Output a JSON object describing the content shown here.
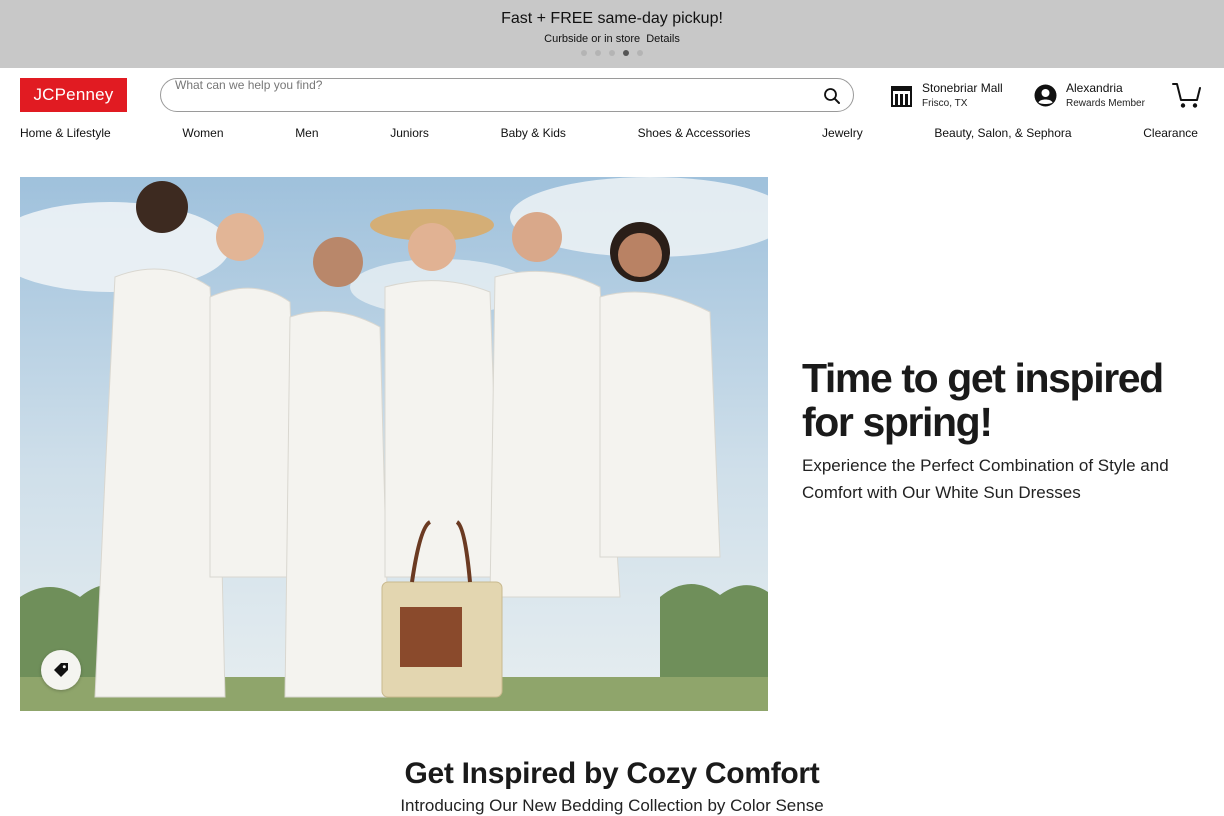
{
  "promo": {
    "title": "Fast + FREE same-day pickup!",
    "subtitle": "Curbside or in store",
    "details_link": "Details",
    "slide_count": 5,
    "active_slide": 4
  },
  "header": {
    "logo_text": "JCPenney",
    "search_placeholder": "What can we help you find?",
    "store": {
      "name": "Stonebriar Mall",
      "location": "Frisco, TX"
    },
    "account": {
      "name": "Alexandria",
      "status": "Rewards Member"
    }
  },
  "nav": {
    "items": [
      "Home & Lifestyle",
      "Women",
      "Men",
      "Juniors",
      "Baby & Kids",
      "Shoes & Accessories",
      "Jewelry",
      "Beauty, Salon, & Sephora",
      "Clearance"
    ]
  },
  "hero": {
    "title": "Time to get inspired for spring!",
    "subtitle": "Experience the Perfect Combination of Style and Comfort with Our White Sun Dresses"
  },
  "section": {
    "title": "Get Inspired by Cozy Comfort",
    "subtitle": "Introducing Our New Bedding Collection by Color Sense"
  },
  "colors": {
    "brand_red": "#e11b22",
    "promo_bg": "#c8c8c8",
    "text": "#1a1a1a"
  },
  "icons": [
    "search-icon",
    "store-icon",
    "account-icon",
    "cart-icon",
    "price-tag-icon"
  ]
}
